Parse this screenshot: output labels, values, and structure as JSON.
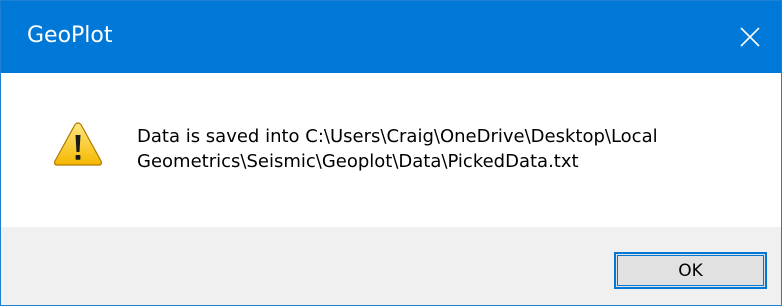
{
  "window": {
    "title": "GeoPlot",
    "close_icon": "close-icon",
    "titlebar_color": "#0078d7"
  },
  "message": {
    "icon": "warning-icon",
    "line1": "Data is saved into C:\\Users\\Craig\\OneDrive\\Desktop\\Local",
    "line2": "Geometrics\\Seismic\\Geoplot\\Data\\PickedData.txt"
  },
  "buttons": {
    "ok_label": "OK"
  }
}
